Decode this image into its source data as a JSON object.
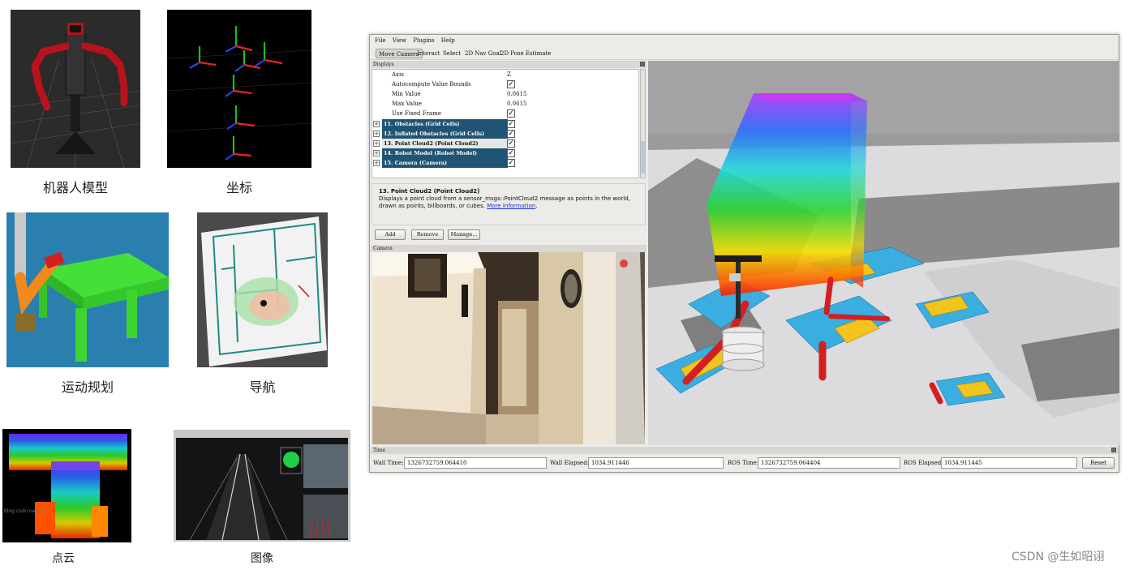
{
  "gallery": {
    "robot_model": "机器人模型",
    "coordinates": "坐标",
    "motion_planning": "运动规划",
    "navigation": "导航",
    "point_cloud": "点云",
    "image": "图像",
    "pointcloud_watermark": "blog.csdn.net/bq"
  },
  "rviz": {
    "menu": [
      "File",
      "View",
      "Plugins",
      "Help"
    ],
    "tools": [
      "Move Camera",
      "Interact",
      "Select",
      "2D Nav Goal",
      "2D Pose Estimate"
    ],
    "displays_title": "Displays",
    "properties": [
      {
        "key": "Axis",
        "value": "Z"
      },
      {
        "key": "Autocompute Value Bounds",
        "value": "checked"
      },
      {
        "key": "Min Value",
        "value": "0.0615"
      },
      {
        "key": "Max Value",
        "value": "0.0615"
      },
      {
        "key": "Use Fixed Frame",
        "value": "checked"
      }
    ],
    "displays": [
      "11. Obstacles (Grid Cells)",
      "12. Inflated Obstacles (Grid Cells)",
      "13. Point Cloud2 (Point Cloud2)",
      "14. Robot Model (Robot Model)",
      "15. Camera (Camera)"
    ],
    "selected_display": "13. Point Cloud2 (Point Cloud2)",
    "description_title": "13. Point Cloud2 (Point Cloud2)",
    "description_text": "Displays a point cloud from a sensor_msgs::PointCloud2 message as points in the world, drawn as points, billboards, or cubes.",
    "description_link": "More Information",
    "buttons": {
      "add": "Add",
      "remove": "Remove",
      "manage": "Manage..."
    },
    "camera_title": "Camera",
    "time_title": "Time",
    "time": {
      "wall_time_label": "Wall Time:",
      "wall_time": "1326732759.064410",
      "wall_elapsed_label": "Wall Elapsed:",
      "wall_elapsed": "1034.911446",
      "ros_time_label": "ROS Time:",
      "ros_time": "1326732759.064404",
      "ros_elapsed_label": "ROS Elapsed:",
      "ros_elapsed": "1034.911445",
      "reset": "Reset"
    }
  },
  "watermark": "CSDN @生如昭诩",
  "colors": {
    "display_row": "#1f5474",
    "robot_red": "#c8262a",
    "grid_cyan": "#3aa9de",
    "grid_yellow": "#f2c21d"
  }
}
